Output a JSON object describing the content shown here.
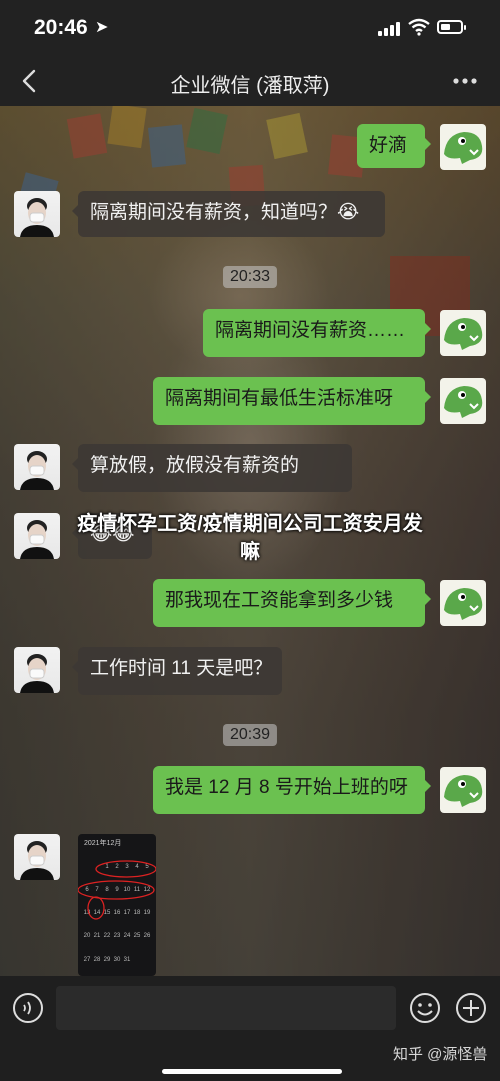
{
  "status_bar": {
    "time": "20:46",
    "location_arrow": "➤"
  },
  "nav": {
    "title": "企业微信 (潘取萍)",
    "back_icon": "chevron-left-icon",
    "more_icon": "more-icon"
  },
  "messages": [
    {
      "side": "right",
      "text": "好滴"
    },
    {
      "side": "left",
      "text": "隔离期间没有薪资，知道吗？😭"
    },
    {
      "timestamp": "20:33"
    },
    {
      "side": "right",
      "text": "隔离期间没有薪资……"
    },
    {
      "side": "right",
      "text": "隔离期间有最低生活标准呀"
    },
    {
      "side": "left",
      "text": "算放假，放假没有薪资的"
    },
    {
      "side": "left",
      "text": "😂😂"
    },
    {
      "side": "right",
      "text": "那我现在工资能拿到多少钱"
    },
    {
      "side": "left",
      "text": "工作时间 11 天是吧？"
    },
    {
      "timestamp": "20:39"
    },
    {
      "side": "right",
      "text": "我是 12 月 8 号开始上班的呀"
    },
    {
      "side": "left",
      "type": "image",
      "caption": "2021年12月"
    }
  ],
  "overlay_caption": "疫情怀孕工资/疫情期间公司工资安月发嘛",
  "calendar": {
    "title": "2021年12月",
    "days": [
      "",
      "",
      "1",
      "2",
      "3",
      "4",
      "5",
      "6",
      "7",
      "8",
      "9",
      "10",
      "11",
      "12",
      "13",
      "14",
      "15",
      "16",
      "17",
      "18",
      "19",
      "20",
      "21",
      "22",
      "23",
      "24",
      "25",
      "26",
      "27",
      "28",
      "29",
      "30",
      "31",
      "",
      "",
      ""
    ]
  },
  "input_bar": {
    "placeholder": "",
    "voice_icon": "voice-icon",
    "emoji_icon": "emoji-icon",
    "plus_icon": "plus-icon"
  },
  "watermark": "知乎 @源怪兽",
  "colors": {
    "bubble_out": "#6bc150",
    "bubble_in": "#3c3834",
    "bar": "#222222"
  }
}
